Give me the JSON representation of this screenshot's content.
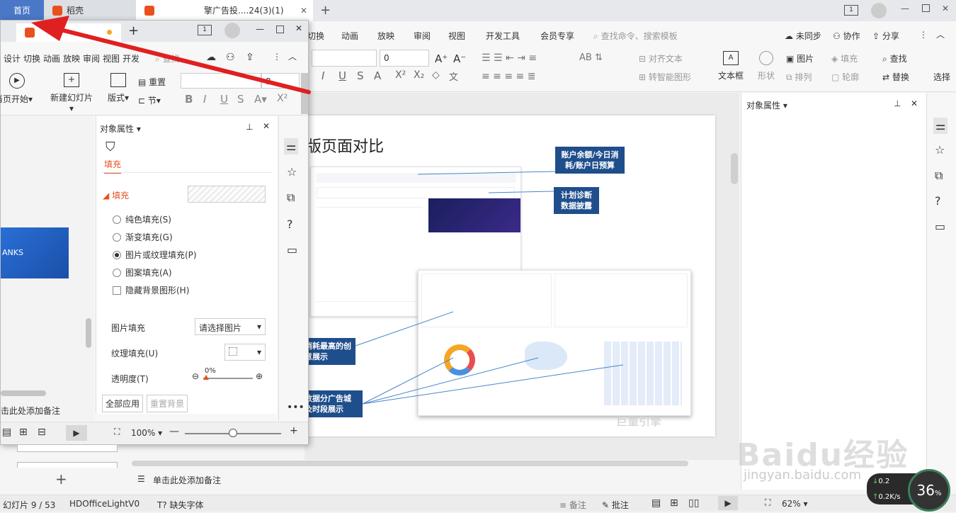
{
  "tabs": {
    "home": "首页",
    "daoke": "稻壳",
    "doc": "擎广告投....24(3)(1)"
  },
  "back_ribbon_tabs": [
    "切换",
    "动画",
    "放映",
    "审阅",
    "视图",
    "开发工具",
    "会员专享"
  ],
  "search_label": "查找命令、搜索模板",
  "top_actions": {
    "sync": "未同步",
    "collab": "协作",
    "share": "分享"
  },
  "font_size": "0",
  "back_ribbon_tools": {
    "align_text": "对齐文本",
    "smart_graphic": "转智能图形",
    "textbox": "文本框",
    "shape": "形状",
    "picture": "图片",
    "arrange": "排列",
    "fill": "填充",
    "outline": "轮廓",
    "find": "查找",
    "replace": "替换",
    "select": "选择"
  },
  "right_panel_title": "对象属性",
  "slide": {
    "title": "版页面对比",
    "callout1": "账户余额/今日消耗/账户日预算",
    "callout2": "计划诊断数据披露",
    "callout3": "消耗最高的创意展示",
    "callout4": "数据分广告城及时段展示",
    "watermark": "巨量引擎"
  },
  "notes_placeholder": "单击此处添加备注",
  "status": {
    "slide_count": "幻灯片 9 / 53",
    "theme": "HDOfficeLightV0",
    "missing_font": "缺失字体",
    "notes": "备注",
    "comments": "批注",
    "zoom": "62%"
  },
  "front": {
    "ribbon_tabs": [
      "设计",
      "切换",
      "动画",
      "放映",
      "审阅",
      "视图",
      "开发"
    ],
    "search": "查找",
    "start_from": "当页开始",
    "new_slide": "新建幻灯片",
    "layout": "版式",
    "reset": "重置",
    "section": "节",
    "font_size": "8",
    "panel_title": "对象属性",
    "fill_tab": "填充",
    "fill_section": "填充",
    "options": [
      "纯色填充(S)",
      "渐变填充(G)",
      "图片或纹理填充(P)",
      "图案填充(A)"
    ],
    "hide_bg": "隐藏背景图形(H)",
    "picture_fill": "图片填充",
    "picture_fill_value": "请选择图片",
    "texture_fill": "纹理填充(U)",
    "transparency": "透明度(T)",
    "transparency_value": "0%",
    "apply_all": "全部应用",
    "reset_bg": "重置背景",
    "notes": "击此处添加备注",
    "zoom": "100%",
    "thumb_text": "ANKS"
  },
  "watermark": {
    "brand": "Baidu经验",
    "url": "jingyan.baidu.com"
  },
  "net": {
    "percent": "36",
    "unit": "%",
    "up": "0.2",
    "upunit": "K/s",
    "down": "0.2"
  },
  "colors": {
    "accent": "#e8511f",
    "callout": "#1f4e8c",
    "arrow": "#e02020"
  }
}
